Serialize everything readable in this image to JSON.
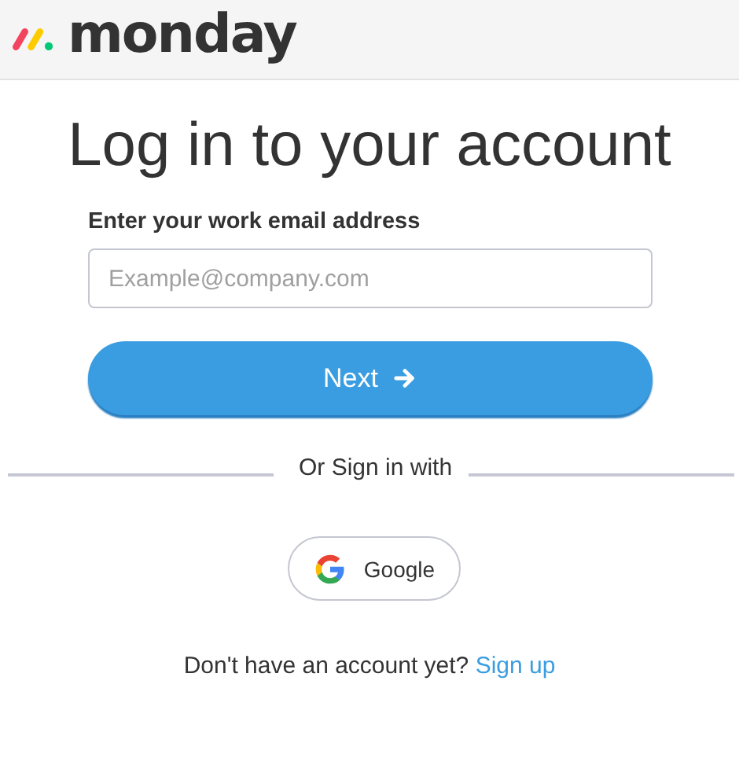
{
  "header": {
    "logo": "monday"
  },
  "title": "Log in to your account",
  "email": {
    "label": "Enter your work email address",
    "placeholder": "Example@company.com"
  },
  "next_button": {
    "label": "Next"
  },
  "divider": {
    "label": "Or Sign in with"
  },
  "google_button": {
    "label": "Google"
  },
  "footer": {
    "text": "Don't have an account yet?",
    "link": "Sign up"
  }
}
